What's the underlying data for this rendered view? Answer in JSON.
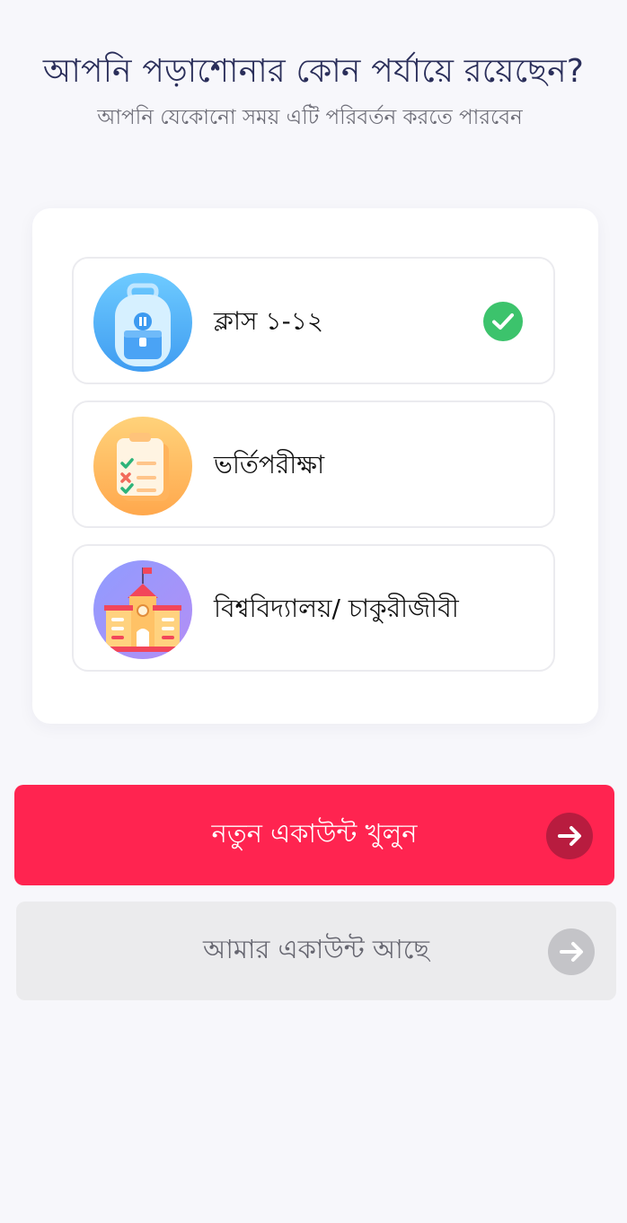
{
  "header": {
    "title": "আপনি পড়াশোনার কোন পর্যায়ে রয়েছেন?",
    "subtitle": "আপনি যেকোনো সময় এটি পরিবর্তন করতে পারবেন"
  },
  "options": [
    {
      "label": "ক্লাস ১-১২",
      "icon": "backpack-icon",
      "selected": true
    },
    {
      "label": "ভর্তিপরীক্ষা",
      "icon": "checklist-icon",
      "selected": false
    },
    {
      "label": "বিশ্ববিদ্যালয়/ চাকুরীজীবী",
      "icon": "university-building-icon",
      "selected": false
    }
  ],
  "buttons": {
    "create_account": "নতুন একাউন্ট খুলুন",
    "have_account": "আমার একাউন্ট আছে"
  },
  "colors": {
    "primary": "#ff2450",
    "check": "#3cc36c",
    "title": "#2a2e5a"
  }
}
